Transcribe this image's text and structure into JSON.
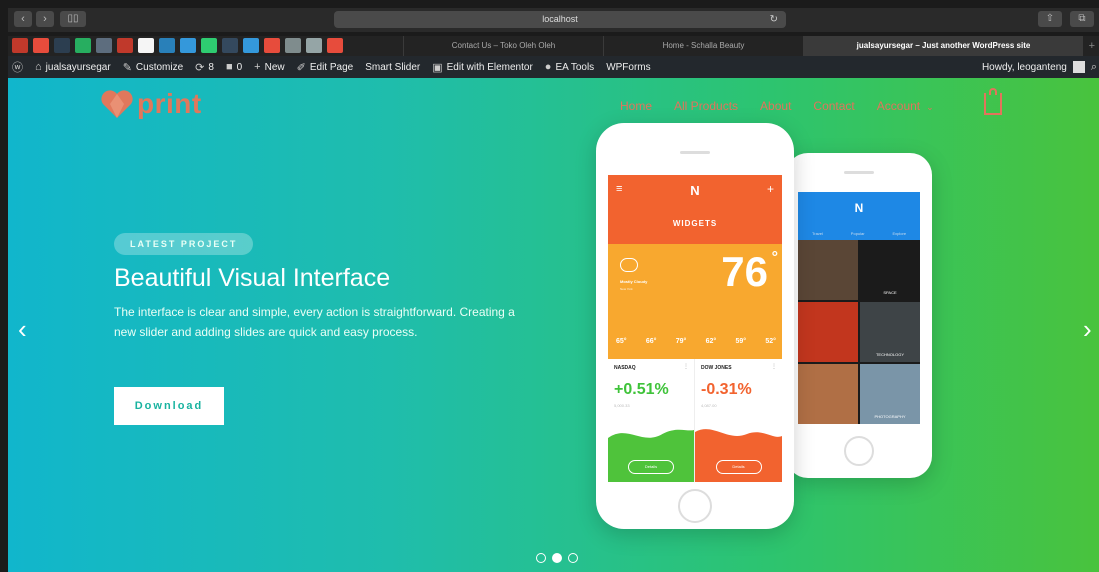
{
  "browser": {
    "url": "localhost",
    "back_glyph": "‹",
    "fwd_glyph": "›",
    "reload_glyph": "↻",
    "tabs": [
      {
        "title": "Contact Us – Toko Oleh Oleh",
        "active": false
      },
      {
        "title": "Home - Schalla Beauty",
        "active": false
      },
      {
        "title": "jualsayursegar – Just another WordPress site",
        "active": true
      }
    ],
    "new_tab_glyph": "+",
    "favicon_colors": [
      "#c0392b",
      "#e74c3c",
      "#2c3e50",
      "#27ae60",
      "#5d6d7e",
      "#c0392b",
      "#f5f5f5",
      "#2980b9",
      "#3498db",
      "#2ecc71",
      "#34495e",
      "#3498db",
      "#e74c3c",
      "#7f8c8d",
      "#95a5a6",
      "#e74c3c"
    ]
  },
  "admin_bar": {
    "wp_icon": "ⓦ",
    "site": "jualsayursegar",
    "customize": "Customize",
    "updates_count": "8",
    "comments_count": "0",
    "new": "New",
    "edit_page": "Edit Page",
    "smart_slider": "Smart Slider",
    "elementor": "Edit with Elementor",
    "ea_tools": "EA Tools",
    "wpforms": "WPForms",
    "howdy": "Howdy, leoganteng",
    "search_icon": "⌕"
  },
  "site": {
    "logo_text": "print",
    "menu": [
      "Home",
      "All Products",
      "About",
      "Contact",
      "Account"
    ],
    "account_arrow": "⌄"
  },
  "hero": {
    "badge": "LATEST PROJECT",
    "title": "Beautiful Visual Interface",
    "description": "The interface is clear and simple, every action is straightforward. Creating a new slider and adding slides are quick and easy process.",
    "button": "Download",
    "prev_arrow": "‹",
    "next_arrow": "›"
  },
  "mockup": {
    "back_app": {
      "logo": "N",
      "tabs": [
        "Travel",
        "Popular",
        "Explore"
      ],
      "tiles": [
        {
          "caption": "",
          "color": "#5a4636"
        },
        {
          "caption": "SPACE",
          "color": "#1b1b1b"
        },
        {
          "caption": "",
          "color": "#c2361e"
        },
        {
          "caption": "TECHNOLOGY",
          "color": "#3e4447"
        },
        {
          "caption": "",
          "color": "#b06f45"
        },
        {
          "caption": "PHOTOGRAPHY",
          "color": "#7a95a8"
        }
      ]
    },
    "front_app": {
      "logo": "N",
      "menu_glyph": "≡",
      "plus_glyph": "+",
      "header": "WIDGETS",
      "weather_label": "Mostly Cloudy",
      "weather_sub": "New York",
      "temperature": "76",
      "degree": "°",
      "forecast": [
        "65°",
        "66°",
        "79°",
        "62°",
        "59°",
        "52°"
      ],
      "stocks": [
        {
          "name": "NASDAQ",
          "value": "+0.51%",
          "sub": "5,000.33",
          "color": "#3fc33a",
          "wave": "#4fc33b"
        },
        {
          "name": "DOW JONES",
          "value": "-0.31%",
          "sub": "4,087.00",
          "color": "#f2632f",
          "wave": "#f2632f"
        }
      ],
      "details": "Details",
      "more_glyph": "⋮"
    }
  },
  "slider": {
    "dots": 3,
    "active_dot": 1
  },
  "colors": {
    "brand": "#e3735c",
    "orange": "#f2632f",
    "yellow": "#f8a82f",
    "green": "#3fc33a",
    "blue": "#1e88e5"
  }
}
